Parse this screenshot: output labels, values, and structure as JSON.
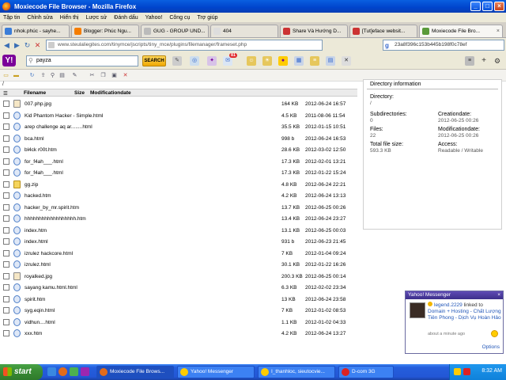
{
  "window": {
    "title": "Moxiecode File Browser - Mozilla Firefox"
  },
  "menu": [
    "Tập tin",
    "Chỉnh sửa",
    "Hiển thị",
    "Lược sử",
    "Đánh dấu",
    "Yahoo!",
    "Công cụ",
    "Trợ giúp"
  ],
  "tabs": [
    {
      "label": "nhok.phúc - sayhe...",
      "active": false
    },
    {
      "label": "Blogger: Phúc Ngu...",
      "active": false
    },
    {
      "label": "GUG - GROUP UND...",
      "active": false
    },
    {
      "label": "404",
      "active": false
    },
    {
      "label": "Share Và Hướng D...",
      "active": false
    },
    {
      "label": "[Tut]eface websit...",
      "active": false
    },
    {
      "label": "Moxiecode File Bro...",
      "active": true
    }
  ],
  "nav": {
    "url": "www.steulaliegites.com/tinymce/jscripts/tiny_mce/plugins/filemanager/frameset.php",
    "search_text": "23a8f396c153b445b198f0c78ef"
  },
  "yahoo": {
    "logo": "Y!",
    "search_value": "payza",
    "search_button": "SEARCH",
    "mail_count": "81"
  },
  "breadcrumb": "/",
  "filelist": {
    "headers": {
      "filename": "Filename",
      "size": "Size",
      "modified": "Modificationdate"
    },
    "rows": [
      {
        "name": "007.php.jpg",
        "size": "164 KB",
        "date": "2012-06-24 16:57",
        "type": "img"
      },
      {
        "name": "Kid Phantom Hacker - Simple.html",
        "size": "4.5 KB",
        "date": "2011-08-06 11:54",
        "type": "web"
      },
      {
        "name": "arep challenge aq ar........html",
        "size": "35.5 KB",
        "date": "2012-01-15 10:51",
        "type": "web"
      },
      {
        "name": "bca.html",
        "size": "998 b",
        "date": "2012-06-24 16:53",
        "type": "web"
      },
      {
        "name": "bl4ck r00t.htm",
        "size": "28.6 KB",
        "date": "2012-03-02 12:50",
        "type": "web"
      },
      {
        "name": "for_f4ah___.html",
        "size": "17.3 KB",
        "date": "2012-02-01 13:21",
        "type": "web"
      },
      {
        "name": "for_f4ah___.html",
        "size": "17.3 KB",
        "date": "2012-01-22 15:24",
        "type": "web"
      },
      {
        "name": "gg.zip",
        "size": "4.8 KB",
        "date": "2012-06-24 22:21",
        "type": "zip"
      },
      {
        "name": "hacked.htm",
        "size": "4.2 KB",
        "date": "2012-06-24 13:13",
        "type": "web"
      },
      {
        "name": "hacker_by_mr.spirit.htm",
        "size": "13.7 KB",
        "date": "2012-06-25 00:26",
        "type": "web"
      },
      {
        "name": "hhhhhhhhhhhhhhhhhh.htm",
        "size": "13.4 KB",
        "date": "2012-06-24 23:27",
        "type": "web"
      },
      {
        "name": "index.htm",
        "size": "13.1 KB",
        "date": "2012-06-25 00:03",
        "type": "web"
      },
      {
        "name": "index.html",
        "size": "931 b",
        "date": "2012-06-23 21:45",
        "type": "web"
      },
      {
        "name": "izrulez hackcore.html",
        "size": "7 KB",
        "date": "2012-01-04 09:24",
        "type": "web"
      },
      {
        "name": "izrulez.html",
        "size": "30.1 KB",
        "date": "2012-01-22 16:26",
        "type": "web"
      },
      {
        "name": "royalked.jpg",
        "size": "200.3 KB",
        "date": "2012-06-25 00:14",
        "type": "img"
      },
      {
        "name": "sayang kamu.html.html",
        "size": "6.3 KB",
        "date": "2012-02-02 23:34",
        "type": "web"
      },
      {
        "name": "spirit.htm",
        "size": "13 KB",
        "date": "2012-06-24 23:58",
        "type": "web"
      },
      {
        "name": "syg.eqin.html",
        "size": "7 KB",
        "date": "2012-01-02 08:53",
        "type": "web"
      },
      {
        "name": "vidhun....html",
        "size": "1.1 KB",
        "date": "2012-01-02 04:33",
        "type": "web"
      },
      {
        "name": "xxx.htm",
        "size": "4.2 KB",
        "date": "2012-06-24 13:27",
        "type": "web"
      }
    ]
  },
  "dirinfo": {
    "title": "Directory information",
    "directory_label": "Directory:",
    "directory_value": "/",
    "subdirs_label": "Subdirectories:",
    "subdirs_value": "0",
    "creation_label": "Creationdate:",
    "creation_value": "2012-06-25 00:26",
    "files_label": "Files:",
    "files_value": "22",
    "mod_label": "Modificationdate:",
    "mod_value": "2012-06-25 00:26",
    "total_label": "Total file size:",
    "total_value": "593.3 KB",
    "access_label": "Access:",
    "access_value": "Readable / Writable"
  },
  "messenger": {
    "title": "Yahoo! Messenger",
    "user": "legend.2229",
    "linked": "linked to",
    "link_text": "Domain + Hosting - Chất Lượng Tiên Phong - Dịch Vụ Hoàn Hảo",
    "time": "about a minute ago",
    "options": "Options"
  },
  "taskbar": {
    "start": "start",
    "buttons": [
      {
        "label": "Moxiecode File Brows...",
        "active": true
      },
      {
        "label": "Yahoo! Messenger",
        "active": false
      },
      {
        "label": "I_thanhloc, sieutocvie...",
        "active": false
      },
      {
        "label": "D-com 3G",
        "active": false
      }
    ],
    "clock": "8:32 AM"
  },
  "colors": {
    "titlebar": "#0a52d8",
    "taskbar": "#245edc",
    "start": "#3a8d35",
    "link": "#2156b8"
  }
}
